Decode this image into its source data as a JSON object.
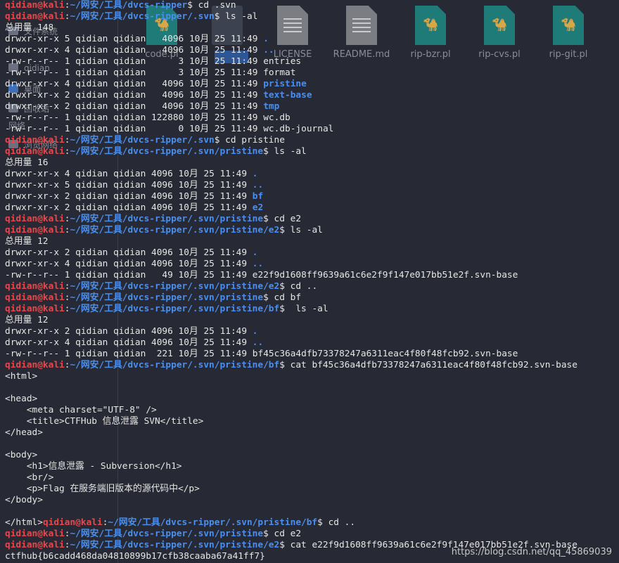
{
  "desktop": {
    "files": [
      {
        "label": "code.pl",
        "icon": "camel-script-icon"
      },
      {
        "label": "",
        "icon": "folder-icon"
      },
      {
        "label": "LICENSE",
        "icon": "text-document-icon"
      },
      {
        "label": "README.md",
        "icon": "text-document-icon"
      },
      {
        "label": "rip-bzr.pl",
        "icon": "camel-script-icon"
      },
      {
        "label": "rip-cvs.pl",
        "icon": "camel-script-icon"
      },
      {
        "label": "rip-git.pl",
        "icon": "camel-script-icon"
      }
    ],
    "sidebar": [
      "文件系统",
      "qidian",
      "桌面",
      "回收站",
      "网络",
      "浏览网络"
    ]
  },
  "prompt": {
    "user": "qidian@kali",
    "sep": ":"
  },
  "lines": [
    {
      "type": "cmd",
      "path": "~/网安/工具/dvcs-ripper",
      "cmd": "cd .svn"
    },
    {
      "type": "cmd",
      "path": "~/网安/工具/dvcs-ripper/.svn",
      "cmd": "ls -al"
    },
    {
      "type": "out",
      "text": "总用量 148"
    },
    {
      "type": "ls",
      "meta": "drwxr-xr-x 5 qidian qidian   4096 10月 25 11:49 ",
      "name": ".",
      "dir": true
    },
    {
      "type": "ls",
      "meta": "drwxr-xr-x 4 qidian qidian   4096 10月 25 11:49 ",
      "name": "..",
      "dir": true
    },
    {
      "type": "ls",
      "meta": "-rw-r--r-- 1 qidian qidian      3 10月 25 11:49 ",
      "name": "entries",
      "dir": false
    },
    {
      "type": "ls",
      "meta": "-rw-r--r-- 1 qidian qidian      3 10月 25 11:49 ",
      "name": "format",
      "dir": false
    },
    {
      "type": "ls",
      "meta": "drwxr-xr-x 4 qidian qidian   4096 10月 25 11:49 ",
      "name": "pristine",
      "dir": true
    },
    {
      "type": "ls",
      "meta": "drwxr-xr-x 2 qidian qidian   4096 10月 25 11:49 ",
      "name": "text-base",
      "dir": true
    },
    {
      "type": "ls",
      "meta": "drwxr-xr-x 2 qidian qidian   4096 10月 25 11:49 ",
      "name": "tmp",
      "dir": true
    },
    {
      "type": "ls",
      "meta": "-rw-r--r-- 1 qidian qidian 122880 10月 25 11:49 ",
      "name": "wc.db",
      "dir": false
    },
    {
      "type": "ls",
      "meta": "-rw-r--r-- 1 qidian qidian      0 10月 25 11:49 ",
      "name": "wc.db-journal",
      "dir": false
    },
    {
      "type": "cmd",
      "path": "~/网安/工具/dvcs-ripper/.svn",
      "cmd": "cd pristine"
    },
    {
      "type": "cmd",
      "path": "~/网安/工具/dvcs-ripper/.svn/pristine",
      "cmd": "ls -al"
    },
    {
      "type": "out",
      "text": "总用量 16"
    },
    {
      "type": "ls",
      "meta": "drwxr-xr-x 4 qidian qidian 4096 10月 25 11:49 ",
      "name": ".",
      "dir": true
    },
    {
      "type": "ls",
      "meta": "drwxr-xr-x 5 qidian qidian 4096 10月 25 11:49 ",
      "name": "..",
      "dir": true
    },
    {
      "type": "ls",
      "meta": "drwxr-xr-x 2 qidian qidian 4096 10月 25 11:49 ",
      "name": "bf",
      "dir": true
    },
    {
      "type": "ls",
      "meta": "drwxr-xr-x 2 qidian qidian 4096 10月 25 11:49 ",
      "name": "e2",
      "dir": true
    },
    {
      "type": "cmd",
      "path": "~/网安/工具/dvcs-ripper/.svn/pristine",
      "cmd": "cd e2"
    },
    {
      "type": "cmd",
      "path": "~/网安/工具/dvcs-ripper/.svn/pristine/e2",
      "cmd": "ls -al"
    },
    {
      "type": "out",
      "text": "总用量 12"
    },
    {
      "type": "ls",
      "meta": "drwxr-xr-x 2 qidian qidian 4096 10月 25 11:49 ",
      "name": ".",
      "dir": true
    },
    {
      "type": "ls",
      "meta": "drwxr-xr-x 4 qidian qidian 4096 10月 25 11:49 ",
      "name": "..",
      "dir": true
    },
    {
      "type": "ls",
      "meta": "-rw-r--r-- 1 qidian qidian   49 10月 25 11:49 ",
      "name": "e22f9d1608ff9639a61c6e2f9f147e017bb51e2f.svn-base",
      "dir": false
    },
    {
      "type": "cmd",
      "path": "~/网安/工具/dvcs-ripper/.svn/pristine/e2",
      "cmd": "cd .."
    },
    {
      "type": "cmd",
      "path": "~/网安/工具/dvcs-ripper/.svn/pristine",
      "cmd": "cd bf"
    },
    {
      "type": "cmd",
      "path": "~/网安/工具/dvcs-ripper/.svn/pristine/bf",
      "cmd": " ls -al"
    },
    {
      "type": "out",
      "text": "总用量 12"
    },
    {
      "type": "ls",
      "meta": "drwxr-xr-x 2 qidian qidian 4096 10月 25 11:49 ",
      "name": ".",
      "dir": true
    },
    {
      "type": "ls",
      "meta": "drwxr-xr-x 4 qidian qidian 4096 10月 25 11:49 ",
      "name": "..",
      "dir": true
    },
    {
      "type": "ls",
      "meta": "-rw-r--r-- 1 qidian qidian  221 10月 25 11:49 ",
      "name": "bf45c36a4dfb73378247a6311eac4f80f48fcb92.svn-base",
      "dir": false
    },
    {
      "type": "cmd",
      "path": "~/网安/工具/dvcs-ripper/.svn/pristine/bf",
      "cmd": "cat bf45c36a4dfb73378247a6311eac4f80f48fcb92.svn-base"
    },
    {
      "type": "out",
      "text": "<html>"
    },
    {
      "type": "out",
      "text": ""
    },
    {
      "type": "out",
      "text": "<head>"
    },
    {
      "type": "out",
      "text": "    <meta charset=\"UTF-8\" />"
    },
    {
      "type": "out",
      "text": "    <title>CTFHub 信息泄露 SVN</title>"
    },
    {
      "type": "out",
      "text": "</head>"
    },
    {
      "type": "out",
      "text": ""
    },
    {
      "type": "out",
      "text": "<body>"
    },
    {
      "type": "out",
      "text": "    <h1>信息泄露 - Subversion</h1>"
    },
    {
      "type": "out",
      "text": "    <br/>"
    },
    {
      "type": "out",
      "text": "    <p>Flag 在服务端旧版本的源代码中</p>"
    },
    {
      "type": "out",
      "text": "</body>"
    },
    {
      "type": "out",
      "text": ""
    },
    {
      "type": "cmd",
      "lead": "</html>",
      "path": "~/网安/工具/dvcs-ripper/.svn/pristine/bf",
      "cmd": "cd .."
    },
    {
      "type": "cmd",
      "path": "~/网安/工具/dvcs-ripper/.svn/pristine",
      "cmd": "cd e2"
    },
    {
      "type": "cmd",
      "path": "~/网安/工具/dvcs-ripper/.svn/pristine/e2",
      "cmd": "cat e22f9d1608ff9639a61c6e2f9f147e017bb51e2f.svn-base"
    },
    {
      "type": "out",
      "text": "ctfhub{b6cadd468da04810899b17cfb38caaba67a41ff7}"
    }
  ],
  "watermark": "https://blog.csdn.net/qq_45869039",
  "colors": {
    "user": "#e5484d",
    "path": "#4a8ff0",
    "dir": "#4a8ff0",
    "text": "#e6e6e6",
    "background": "#272a34"
  }
}
